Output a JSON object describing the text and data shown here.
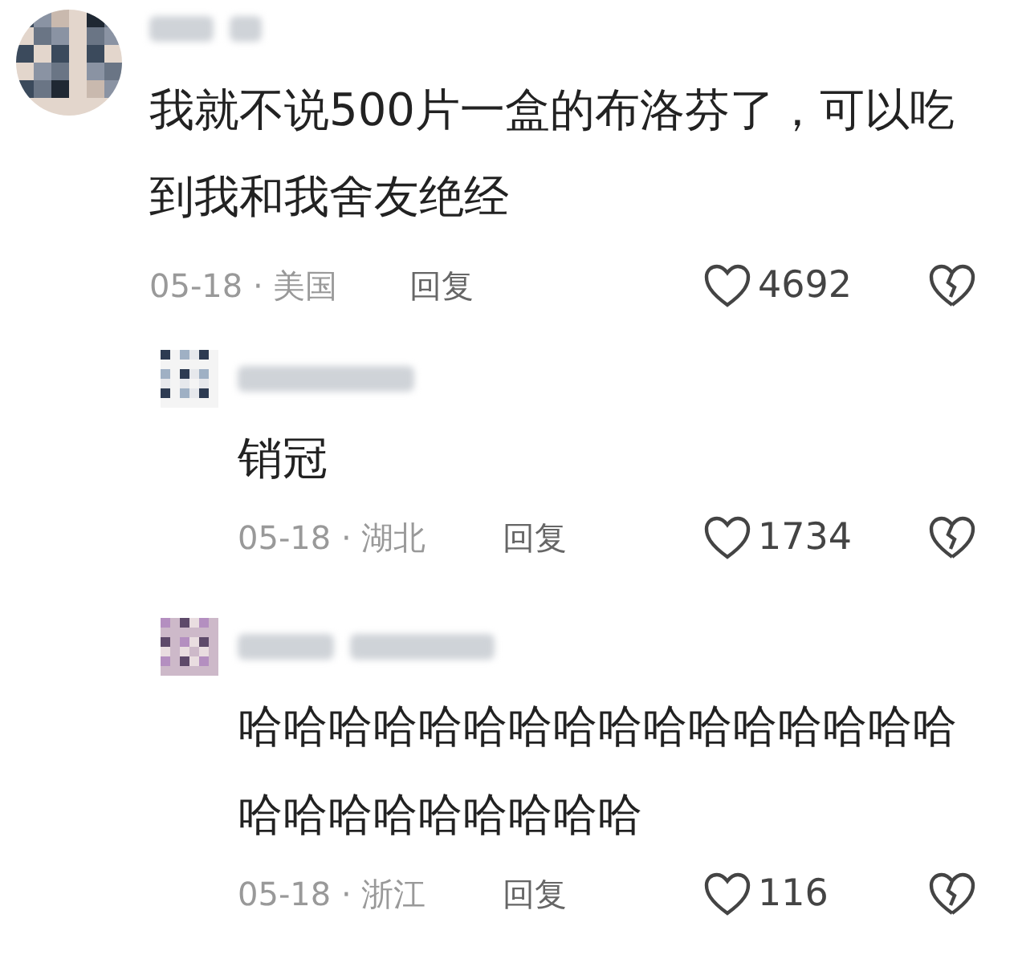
{
  "comments": [
    {
      "text": "我就不说500片一盒的布洛芬了，可以吃到我和我舍友绝经",
      "date_location": "05-18 · 美国",
      "reply_label": "回复",
      "likes": "4692",
      "replies": [
        {
          "text": "销冠",
          "date_location": "05-18 · 湖北",
          "reply_label": "回复",
          "likes": "1734"
        },
        {
          "text": "哈哈哈哈哈哈哈哈哈哈哈哈哈哈哈哈哈哈哈哈哈哈哈哈哈",
          "date_location": "05-18 · 浙江",
          "reply_label": "回复",
          "likes": "116"
        }
      ]
    }
  ]
}
